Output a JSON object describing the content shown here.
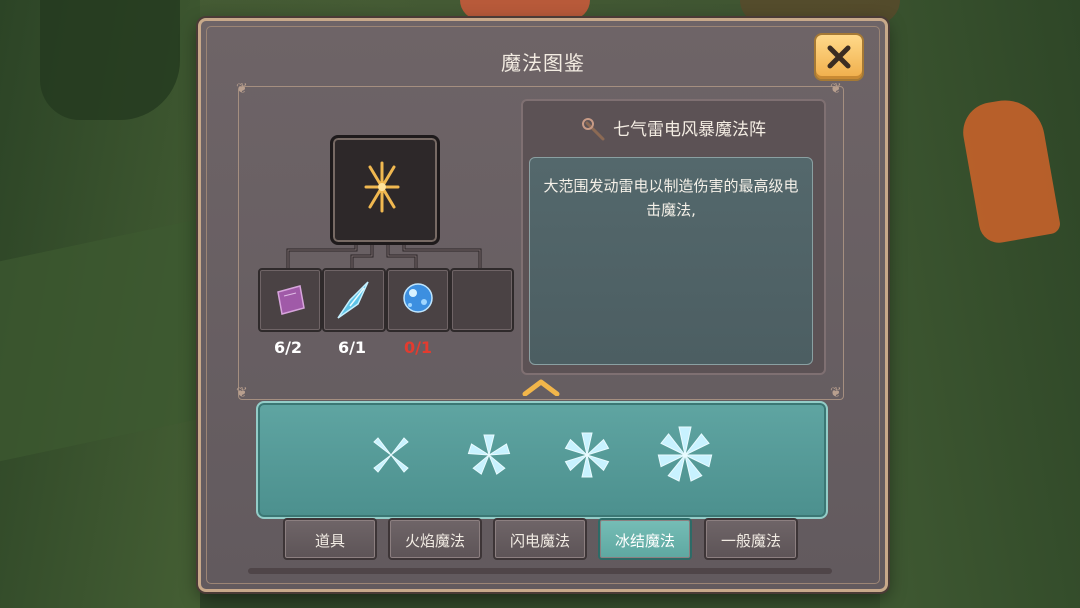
{
  "window": {
    "title": "魔法图鉴",
    "close_icon": "close-icon"
  },
  "spell": {
    "name": "七气雷电风暴魔法阵",
    "name_icon": "staff-icon",
    "icon": "lightning-rune-icon",
    "description": "大范围发动雷电以制造伤害的最高级电击魔法,"
  },
  "materials": [
    {
      "icon": "purple-crystal-icon",
      "count": "6/2",
      "sufficient": true
    },
    {
      "icon": "ice-shard-icon",
      "count": "6/1",
      "sufficient": true
    },
    {
      "icon": "blue-orb-icon",
      "count": "0/1",
      "sufficient": false
    },
    {
      "icon": "empty-slot",
      "count": "",
      "sufficient": true
    }
  ],
  "spell_list": {
    "collapse_icon": "chevron-up-icon",
    "items": [
      {
        "icon": "ice-flower-4-icon"
      },
      {
        "icon": "ice-flower-5-icon"
      },
      {
        "icon": "ice-flower-6-icon"
      },
      {
        "icon": "ice-flower-7-icon"
      }
    ]
  },
  "tabs": [
    {
      "label": "道具",
      "active": false
    },
    {
      "label": "火焰魔法",
      "active": false
    },
    {
      "label": "闪电魔法",
      "active": false
    },
    {
      "label": "冰结魔法",
      "active": true
    },
    {
      "label": "一般魔法",
      "active": false
    }
  ],
  "colors": {
    "panel": "#665d60",
    "accent_teal": "#5fa5a2",
    "gold": "#f0ae4a",
    "insufficient": "#e33b2f"
  }
}
